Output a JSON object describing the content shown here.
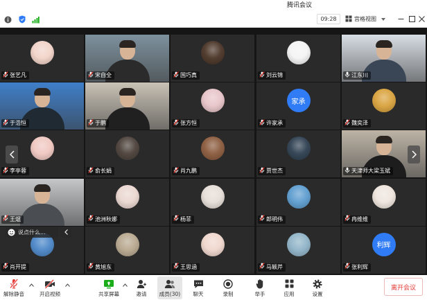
{
  "window": {
    "title": "腾讯会议"
  },
  "topbar": {
    "time": "09:28",
    "view_mode": "宫格视图",
    "icons": [
      "info-icon",
      "shield-icon",
      "signal-icon"
    ]
  },
  "tiles": [
    {
      "name": "张艺凡",
      "kind": "avatar",
      "color": "#f2d3c8",
      "muted": true
    },
    {
      "name": "宋自全",
      "kind": "video",
      "color": "#7d919d",
      "shirt": "#2b2b2b",
      "muted": true
    },
    {
      "name": "国巧真",
      "kind": "avatar",
      "color": "#4a3426",
      "muted": true
    },
    {
      "name": "刘云锦",
      "kind": "avatar",
      "color": "#f4f4f4",
      "muted": true
    },
    {
      "name": "江东川",
      "kind": "video",
      "color": "#d8dee5",
      "shirt": "#3a4656",
      "muted": false
    },
    {
      "name": "于浩恒",
      "kind": "video",
      "color": "#3f7fc9",
      "shirt": "#1f2a33",
      "muted": true
    },
    {
      "name": "于鹏",
      "kind": "video",
      "color": "#c9c2b6",
      "shirt": "#202020",
      "muted": true
    },
    {
      "name": "张方恒",
      "kind": "avatar",
      "color": "#e7c4c8",
      "muted": true
    },
    {
      "name": "许家承",
      "kind": "avatar",
      "color": "#2f7cf6",
      "avatar_text": "家承",
      "muted": true
    },
    {
      "name": "魏奕泽",
      "kind": "avatar",
      "color": "#d9a23c",
      "muted": true
    },
    {
      "name": "李亭蓉",
      "kind": "avatar",
      "color": "#f0c7c0",
      "muted": true
    },
    {
      "name": "俞长娟",
      "kind": "avatar",
      "color": "#4b4039",
      "muted": true
    },
    {
      "name": "肖九鹏",
      "kind": "avatar",
      "color": "#8a5a3c",
      "muted": true
    },
    {
      "name": "贾世杰",
      "kind": "avatar",
      "color": "#2e3f50",
      "muted": true
    },
    {
      "name": "天津师大梁玉斌",
      "kind": "video",
      "color": "#bdb4a6",
      "shirt": "#1d1d1d",
      "muted": false
    },
    {
      "name": "王焜",
      "kind": "video",
      "color": "#c5c7c9",
      "shirt": "#4a4d52",
      "muted": true
    },
    {
      "name": "池洲秋娜",
      "kind": "avatar",
      "color": "#ead6d0",
      "muted": true
    },
    {
      "name": "杨菲",
      "kind": "avatar",
      "color": "#e6ddd7",
      "muted": true
    },
    {
      "name": "郎明伟",
      "kind": "avatar",
      "color": "#5c9ccf",
      "muted": true
    },
    {
      "name": "冉维维",
      "kind": "avatar",
      "color": "#eee5dd",
      "muted": true
    },
    {
      "name": "肖开提",
      "kind": "avatar",
      "color": "#4b86c7",
      "muted": true
    },
    {
      "name": "黄旭东",
      "kind": "avatar",
      "color": "#b7a78e",
      "muted": true
    },
    {
      "name": "王思涵",
      "kind": "avatar",
      "color": "#efd6cc",
      "muted": true
    },
    {
      "name": "马颖芹",
      "kind": "avatar",
      "color": "#8fb3c7",
      "muted": true
    },
    {
      "name": "张利辉",
      "kind": "avatar",
      "color": "#2f7cf6",
      "avatar_text": "利辉",
      "muted": true
    }
  ],
  "chat": {
    "placeholder": "说点什么..."
  },
  "toolbar": {
    "unmute": "解除静音",
    "start_video": "开启视频",
    "share_screen": "共享屏幕",
    "invite": "邀请",
    "members": "成员(30)",
    "chat": "聊天",
    "record": "录制",
    "raise_hand": "举手",
    "apps": "应用",
    "settings": "设置",
    "leave": "离开会议"
  },
  "colors": {
    "accent": "#2f7cf6",
    "danger": "#e53935",
    "share": "#1aad19",
    "grid_bg": "#151515"
  }
}
